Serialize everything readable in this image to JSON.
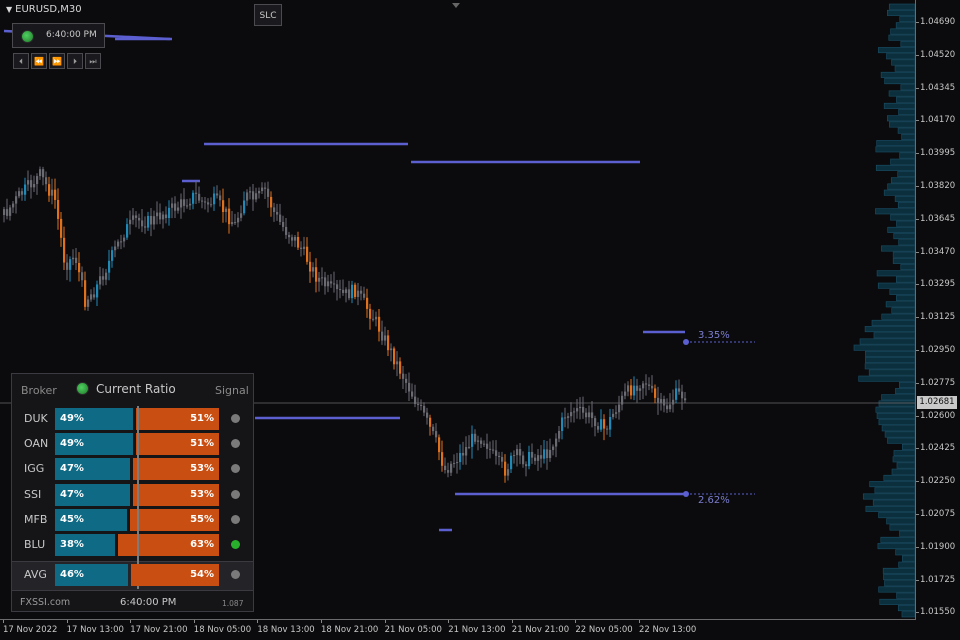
{
  "chart": {
    "symbol": "EURUSD,M30",
    "slc_label": "SLC",
    "clock_time": "6:40:00 PM",
    "current_price": "1.02681",
    "price_labels": [
      "1.04690",
      "1.04520",
      "1.04345",
      "1.04170",
      "1.03995",
      "1.03820",
      "1.03645",
      "1.03470",
      "1.03295",
      "1.03125",
      "1.02950",
      "1.02775",
      "1.02600",
      "1.02425",
      "1.02250",
      "1.02075",
      "1.01900",
      "1.01725",
      "1.01550"
    ],
    "time_labels": [
      "17 Nov 2022",
      "17 Nov 13:00",
      "17 Nov 21:00",
      "18 Nov 05:00",
      "18 Nov 13:00",
      "18 Nov 21:00",
      "21 Nov 05:00",
      "21 Nov 13:00",
      "21 Nov 21:00",
      "22 Nov 05:00",
      "22 Nov 13:00"
    ],
    "levels": {
      "upper_pct": "3.35%",
      "lower_pct": "2.62%"
    },
    "colors": {
      "bull": "#1f8ab8",
      "bear": "#e0711c",
      "neutral": "#6a6a72",
      "level": "#5b5fd0"
    }
  },
  "nav": {
    "buttons": [
      "⏴",
      "⏪",
      "⏩",
      "⏵",
      "⏭"
    ]
  },
  "panel": {
    "header": {
      "broker": "Broker",
      "title": "Current Ratio",
      "signal": "Signal"
    },
    "rows": [
      {
        "broker": "DUK",
        "buy": "49%",
        "sell": "51%",
        "buy_frac": 0.49,
        "signal": "grey"
      },
      {
        "broker": "OAN",
        "buy": "49%",
        "sell": "51%",
        "buy_frac": 0.49,
        "signal": "grey"
      },
      {
        "broker": "IGG",
        "buy": "47%",
        "sell": "53%",
        "buy_frac": 0.47,
        "signal": "grey"
      },
      {
        "broker": "SSI",
        "buy": "47%",
        "sell": "53%",
        "buy_frac": 0.47,
        "signal": "grey"
      },
      {
        "broker": "MFB",
        "buy": "45%",
        "sell": "55%",
        "buy_frac": 0.45,
        "signal": "grey"
      },
      {
        "broker": "BLU",
        "buy": "38%",
        "sell": "63%",
        "buy_frac": 0.38,
        "signal": "green"
      }
    ],
    "avg": {
      "broker": "AVG",
      "buy": "46%",
      "sell": "54%",
      "buy_frac": 0.46,
      "signal": "grey"
    },
    "footer": {
      "brand": "FXSSI.com",
      "time": "6:40:00 PM",
      "version": "1.087"
    }
  }
}
